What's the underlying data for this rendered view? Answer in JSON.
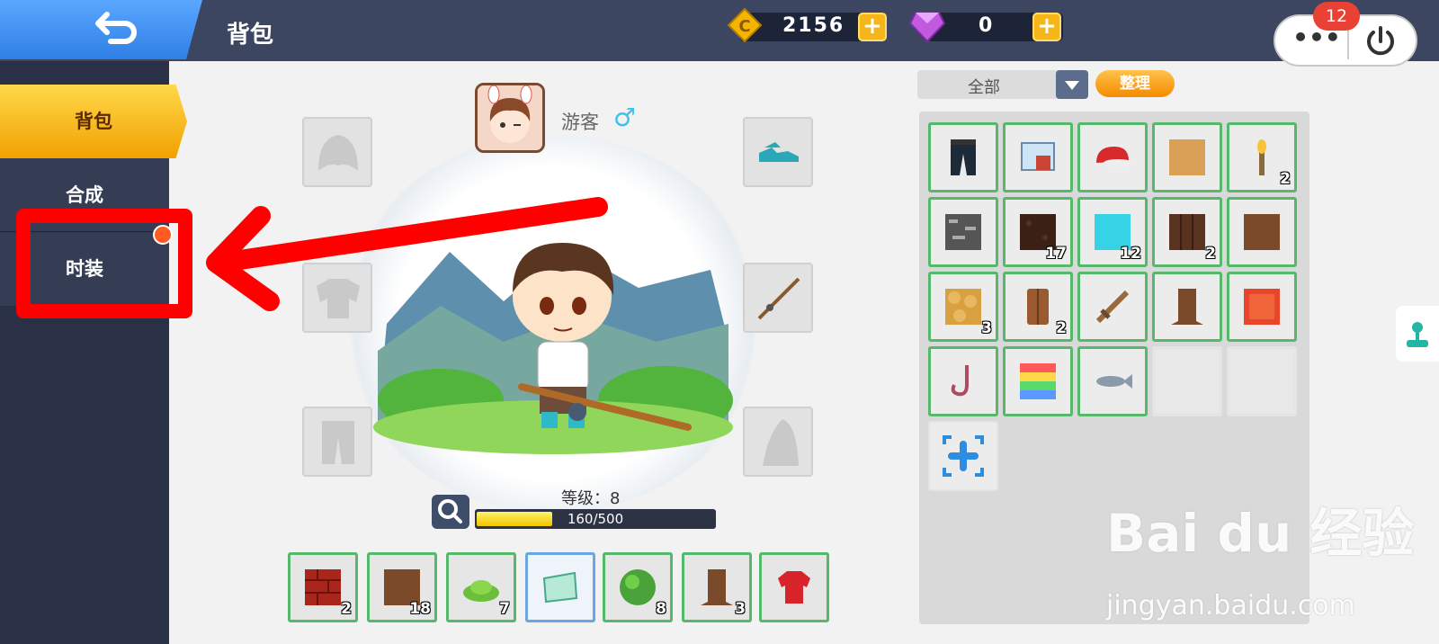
{
  "header": {
    "title": "背包",
    "coins": "2156",
    "gems": "0",
    "notification_count": "12",
    "more_label": "•••"
  },
  "sidebar": {
    "tabs": [
      {
        "label": "背包",
        "active": true
      },
      {
        "label": "合成",
        "active": false
      },
      {
        "label": "时装",
        "active": false,
        "has_dot": true
      }
    ]
  },
  "character": {
    "name": "游客",
    "gender_symbol": "♂",
    "level_label": "等级：8",
    "xp_text": "160/500",
    "xp_fraction": 0.32
  },
  "hotbar": [
    {
      "icon": "red-brick-block-icon",
      "count": "2"
    },
    {
      "icon": "dirt-block-icon",
      "count": "18"
    },
    {
      "icon": "bush-icon",
      "count": "7"
    },
    {
      "icon": "banner-icon",
      "count": "",
      "selected": true
    },
    {
      "icon": "leaf-block-icon",
      "count": "8"
    },
    {
      "icon": "tree-trunk-icon",
      "count": "3"
    },
    {
      "icon": "shirt-icon",
      "count": ""
    }
  ],
  "inventory": {
    "filter_value": "全部",
    "sort_label": "整理",
    "items": [
      {
        "icon": "pants-icon",
        "count": ""
      },
      {
        "icon": "crafting-table-icon",
        "count": ""
      },
      {
        "icon": "red-cap-icon",
        "count": ""
      },
      {
        "icon": "sand-block-icon",
        "count": ""
      },
      {
        "icon": "torch-icon",
        "count": "2"
      },
      {
        "icon": "stone-block-icon",
        "count": ""
      },
      {
        "icon": "dark-soil-block-icon",
        "count": "17"
      },
      {
        "icon": "ice-block-icon",
        "count": "12"
      },
      {
        "icon": "wood-plank-block-icon",
        "count": "2"
      },
      {
        "icon": "dirt-block-icon",
        "count": ""
      },
      {
        "icon": "cobblestone-block-icon",
        "count": "3"
      },
      {
        "icon": "log-icon",
        "count": "2"
      },
      {
        "icon": "wooden-sword-icon",
        "count": ""
      },
      {
        "icon": "tree-trunk-icon",
        "count": ""
      },
      {
        "icon": "red-block-icon",
        "count": ""
      },
      {
        "icon": "fishing-hook-icon",
        "count": ""
      },
      {
        "icon": "rainbow-block-icon",
        "count": ""
      },
      {
        "icon": "fish-icon",
        "count": ""
      }
    ]
  },
  "watermark": {
    "brand": "Bai du 经验",
    "url": "jingyan.baidu.com"
  },
  "colors": {
    "topbar": "#3c4660",
    "sidebar": "#2a3146",
    "active_tab": "#f2a100",
    "slot_border": "#55b86b",
    "annotation": "#ff0000"
  }
}
